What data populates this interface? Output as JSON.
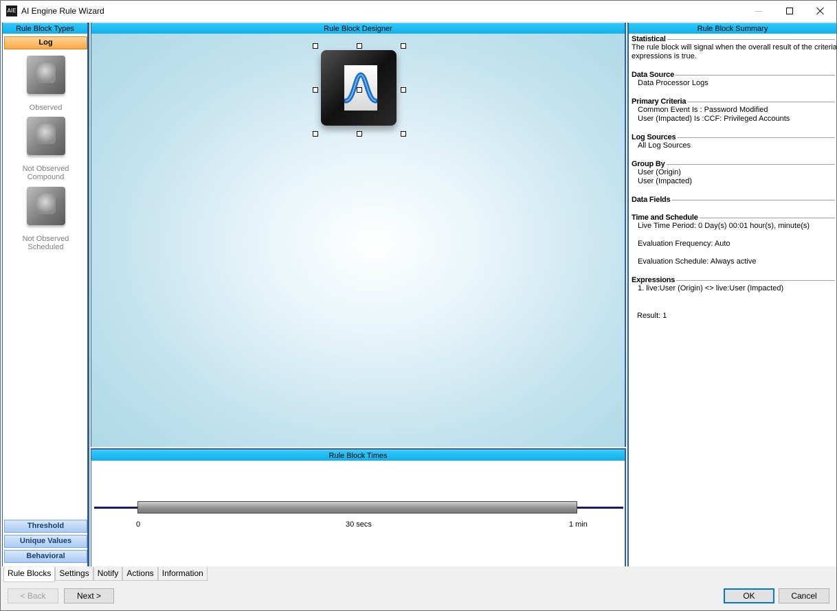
{
  "window": {
    "title": "AI Engine Rule Wizard",
    "icon_text": "AIE"
  },
  "left_panel": {
    "header": "Rule Block Types",
    "log_label": "Log",
    "blocks": [
      {
        "label": "Observed"
      },
      {
        "label": "Not Observed Compound"
      },
      {
        "label": "Not Observed Scheduled"
      }
    ],
    "categories": [
      "Threshold",
      "Unique Values",
      "Behavioral"
    ]
  },
  "designer": {
    "header": "Rule Block Designer"
  },
  "times": {
    "header": "Rule Block Times",
    "ticks": [
      "0",
      "30 secs",
      "1 min"
    ]
  },
  "summary": {
    "header": "Rule Block Summary",
    "statistical": {
      "title": "Statistical",
      "lines": [
        "The rule block will signal when the overall result of the criteria",
        "expressions is true."
      ]
    },
    "data_source": {
      "title": "Data Source",
      "lines": [
        "Data Processor Logs"
      ]
    },
    "primary_criteria": {
      "title": "Primary Criteria",
      "lines": [
        "Common Event Is : Password Modified",
        "User (Impacted) Is :CCF: Privileged Accounts"
      ]
    },
    "log_sources": {
      "title": "Log Sources",
      "lines": [
        "All Log Sources"
      ]
    },
    "group_by": {
      "title": "Group By",
      "lines": [
        "User (Origin)",
        "User (Impacted)"
      ]
    },
    "data_fields": {
      "title": "Data Fields"
    },
    "time_schedule": {
      "title": "Time and Schedule",
      "live_time": "Live Time Period: 0 Day(s) 00:01 hour(s), minute(s)",
      "eval_freq": "Evaluation Frequency: Auto",
      "eval_sched": "Evaluation Schedule: Always active"
    },
    "expressions": {
      "title": "Expressions",
      "lines": [
        "1. live:User (Origin) <> live:User (Impacted)"
      ]
    },
    "result": "Result:  1"
  },
  "tabs": [
    "Rule Blocks",
    "Settings",
    "Notify",
    "Actions",
    "Information"
  ],
  "buttons": {
    "back": "< Back",
    "next": "Next >",
    "ok": "OK",
    "cancel": "Cancel"
  }
}
